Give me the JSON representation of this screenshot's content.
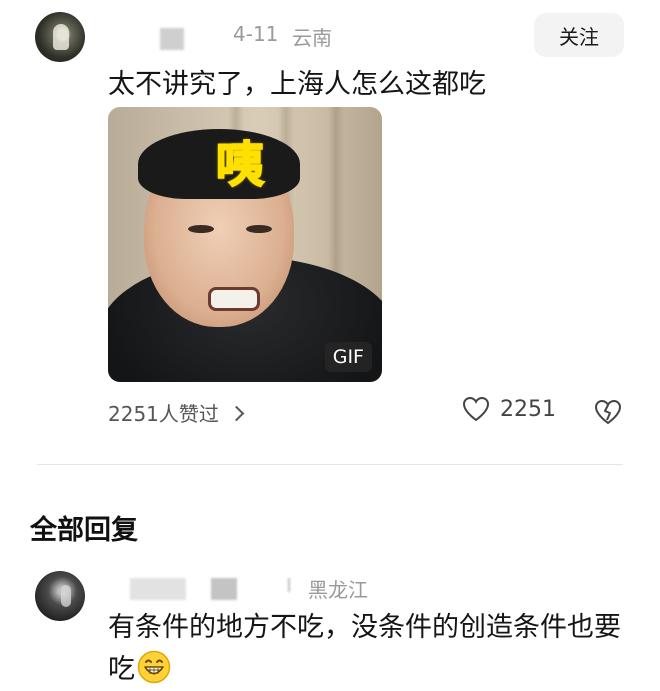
{
  "comment": {
    "date": "4-11",
    "location": "云南",
    "follow_label": "关注",
    "text": "太不讲究了，上海人怎么这都吃",
    "gif": {
      "caption": "咦",
      "badge": "GIF"
    },
    "likers_text": "2251人赞过",
    "like_count": "2251"
  },
  "replies_section": {
    "title": "全部回复"
  },
  "reply": {
    "location": "黑龙江",
    "text": "有条件的地方不吃，没条件的创造条件也要吃"
  },
  "icons": {
    "heart": "heart-icon",
    "broken_heart": "broken-heart-icon",
    "chevron": "chevron-right-icon",
    "emoji": "grin-emoji-icon"
  },
  "colors": {
    "meta_text": "#9a9a9a",
    "follow_bg": "#f3f3f3",
    "caption_red": "#e82a1d",
    "caption_yellow": "#ffe000"
  }
}
